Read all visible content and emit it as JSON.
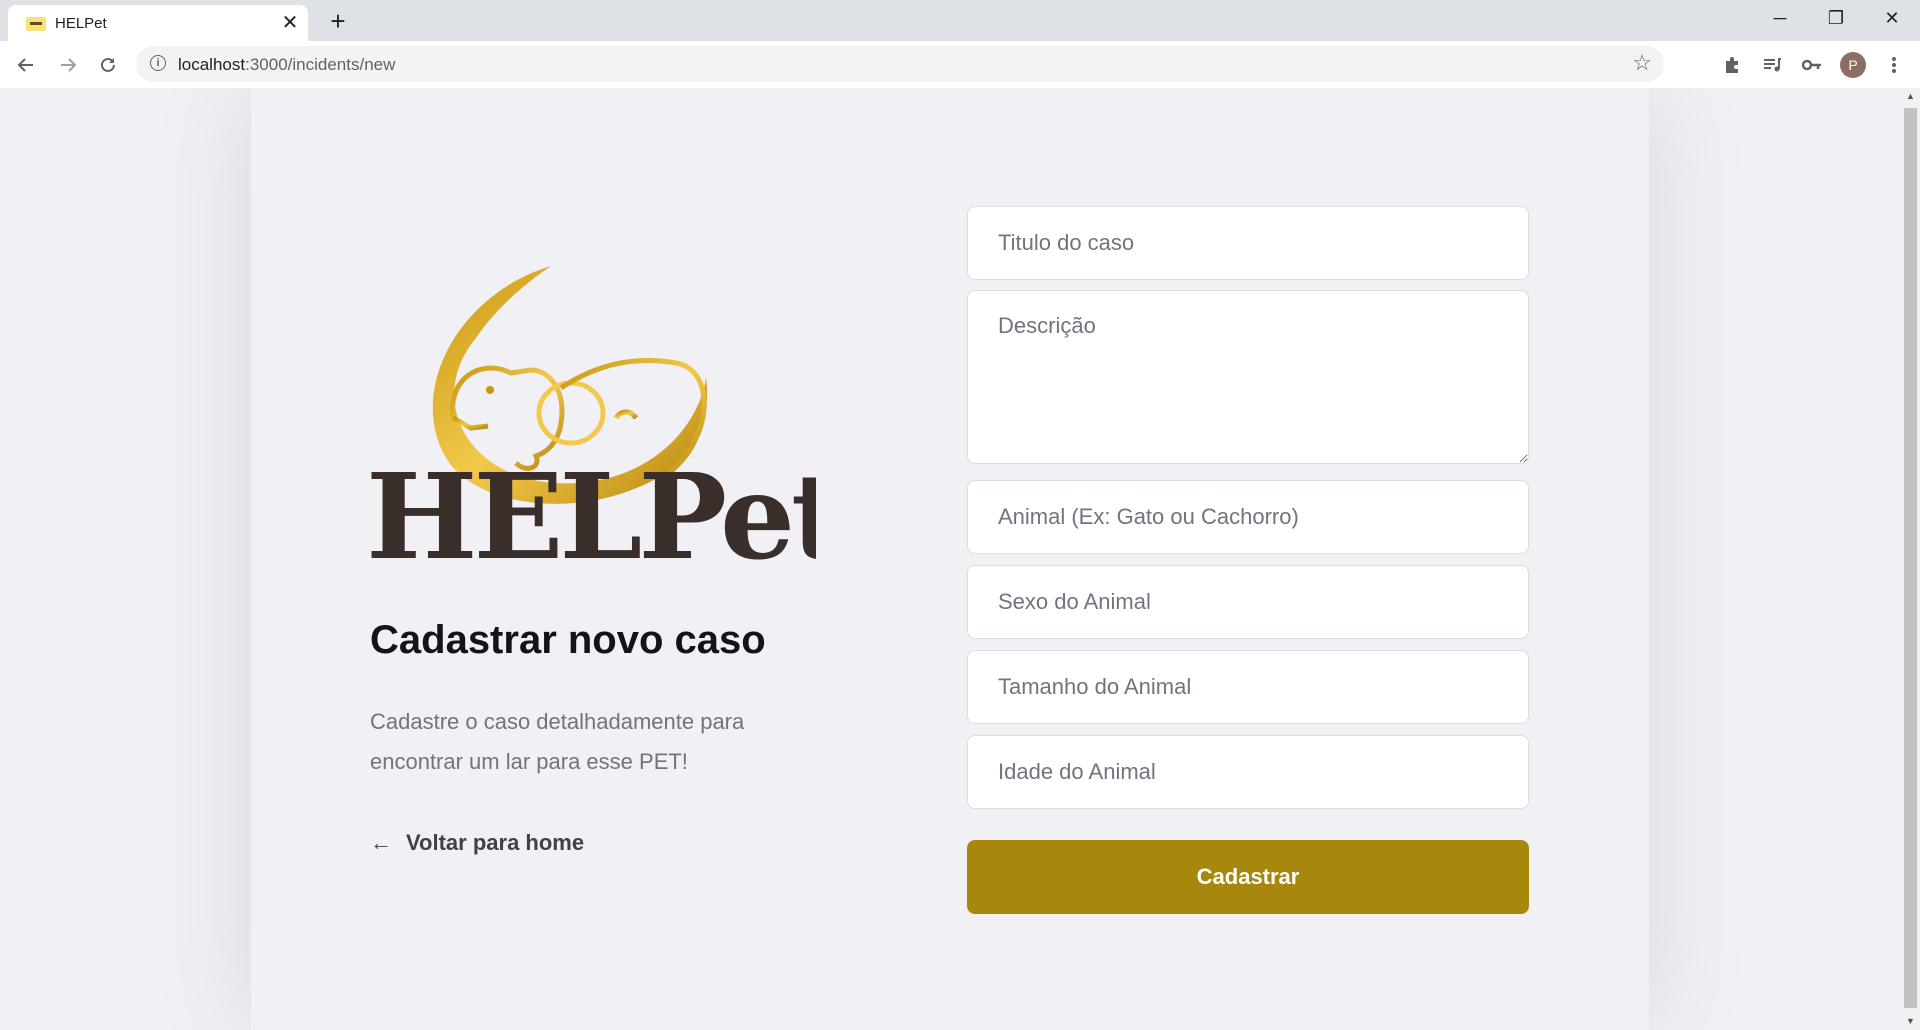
{
  "browser": {
    "tab_title": "HELPet",
    "tab_close": "✕",
    "new_tab": "+",
    "url_host": "localhost",
    "url_rest": ":3000/incidents/new",
    "profile_initial": "P",
    "window_controls": {
      "minimize": "─",
      "maximize": "❐",
      "close": "✕"
    },
    "icons": [
      "back-arrow-icon",
      "forward-arrow-icon",
      "reload-icon",
      "info-icon",
      "star-icon",
      "extensions-icon",
      "media-icon",
      "key-icon",
      "menu-icon"
    ]
  },
  "logo": {
    "text": "HELPet",
    "colors": {
      "gold": "#d8a91c",
      "gold_light": "#f2c94c",
      "dark": "#3a2e2a"
    }
  },
  "main": {
    "title": "Cadastrar novo caso",
    "description": "Cadastre o caso detalhadamente para encontrar um lar para esse PET!",
    "back_link": "Voltar para home"
  },
  "form": {
    "title_placeholder": "Titulo do caso",
    "description_placeholder": "Descrição",
    "animal_placeholder": "Animal (Ex: Gato ou Cachorro)",
    "sex_placeholder": "Sexo do Animal",
    "size_placeholder": "Tamanho do Animal",
    "age_placeholder": "Idade do Animal",
    "submit_label": "Cadastrar"
  },
  "colors": {
    "background": "#f0f0f5",
    "button": "#a7870c",
    "title": "#13131a",
    "text": "#737380"
  }
}
